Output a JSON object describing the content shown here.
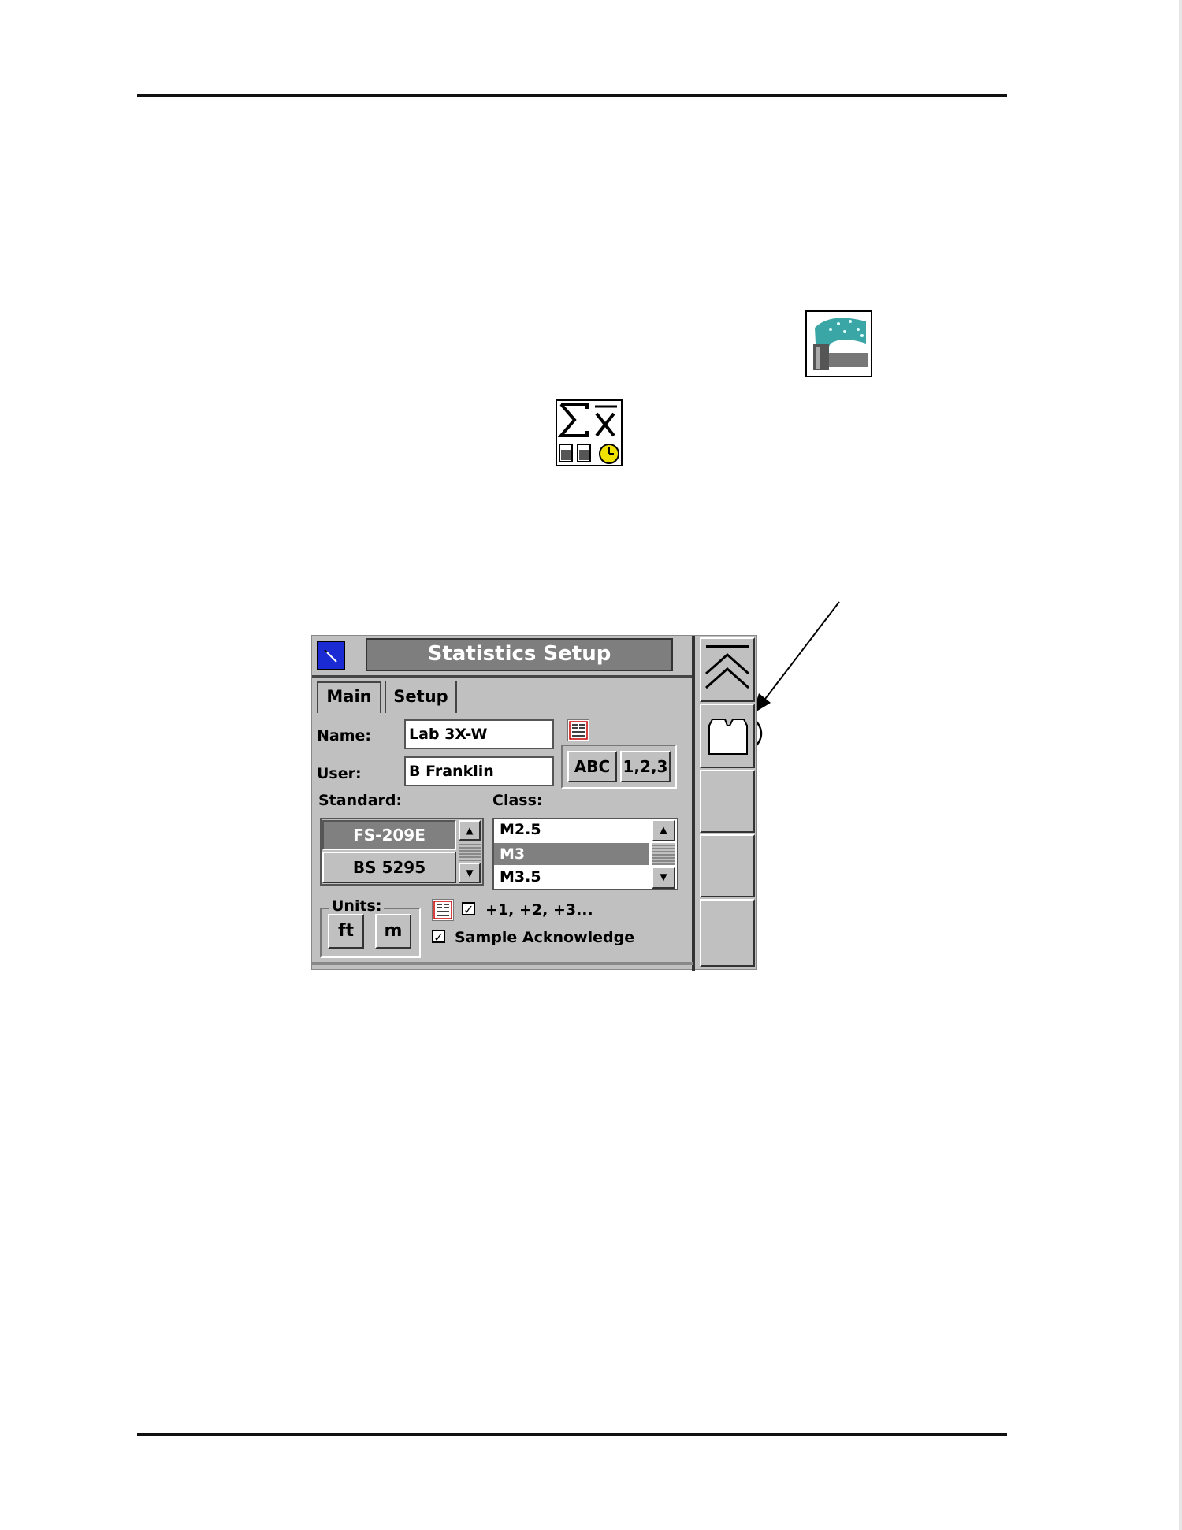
{
  "doc_icons": {
    "fountain": "fountain-icon",
    "statistics": "statistics-icon"
  },
  "window": {
    "title": "Statistics Setup",
    "tabs": [
      "Main",
      "Setup"
    ],
    "name_label": "Name:",
    "name_value": "Lab 3X-W",
    "user_label": "User:",
    "user_value": "B Franklin",
    "keyboard": {
      "alpha": "ABC",
      "numeric": "1,2,3"
    },
    "standard_label": "Standard:",
    "standards": [
      "FS-209E",
      "BS 5295"
    ],
    "standard_selected": "FS-209E",
    "class_label": "Class:",
    "classes": [
      "M2.5",
      "M3",
      "M3.5"
    ],
    "class_selected": "M3",
    "units_label": "Units:",
    "units": [
      "ft",
      "m"
    ],
    "option_increment": {
      "label": "+1, +2, +3...",
      "checked": true
    },
    "option_ack": {
      "label": "Sample Acknowledge",
      "checked": true
    },
    "check_mark": "✓"
  },
  "sidebar": {
    "up_button": "double-chevron-up-icon",
    "folder_button": "folder-icon"
  },
  "colors": {
    "panel": "#c0c0c0",
    "titlebar": "#7e7e7e",
    "selected": "#808080",
    "corner_icon": "#1a2bd4",
    "fountain_teal": "#3aa6a6",
    "clock_yellow": "#f0e000"
  }
}
